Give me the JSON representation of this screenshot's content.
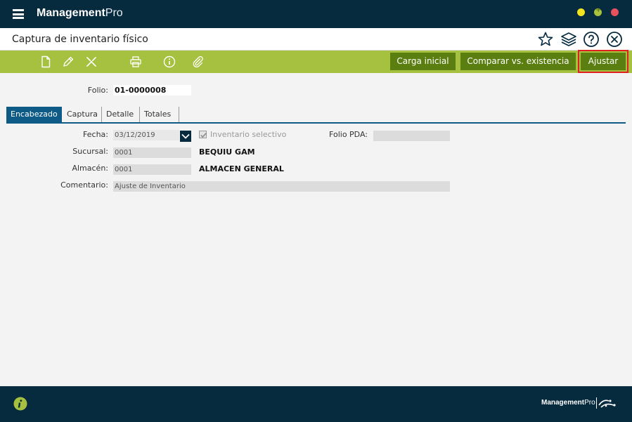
{
  "app": {
    "brand_bold": "Management",
    "brand_light": "Pro"
  },
  "header": {
    "title": "Captura de inventario físico"
  },
  "toolbar": {
    "buttons": {
      "carga_inicial": "Carga inicial",
      "comparar": "Comparar vs. existencia",
      "ajustar": "Ajustar"
    }
  },
  "form": {
    "folio_label": "Folio:",
    "folio_value": "01-0000008",
    "tabs": [
      "Encabezado",
      "Captura",
      "Detalle",
      "Totales"
    ],
    "fecha_label": "Fecha:",
    "fecha_value": "03/12/2019",
    "inventario_selectivo_label": "Inventario selectivo",
    "folio_pda_label": "Folio PDA:",
    "folio_pda_value": "",
    "sucursal_label": "Sucursal:",
    "sucursal_code": "0001",
    "sucursal_name": "BEQUIU GAM",
    "almacen_label": "Almacén:",
    "almacen_code": "0001",
    "almacen_name": "ALMACEN GENERAL",
    "comentario_label": "Comentario:",
    "comentario_value": "Ajuste de Inventario"
  },
  "footer": {
    "brand_bold": "Management",
    "brand_light": "Pro"
  },
  "colors": {
    "titlebar": "#062a3e",
    "toolbar": "#a6c13f",
    "toolbar_button": "#5a7f10",
    "active_tab": "#0e5b87",
    "highlight": "#e02020"
  },
  "icons": [
    "menu-icon",
    "star-icon",
    "layers-icon",
    "help-icon",
    "close-circle-icon",
    "new-document-icon",
    "edit-icon",
    "delete-icon",
    "print-icon",
    "info-icon",
    "attach-icon",
    "chevron-down-icon",
    "checkmark-icon"
  ]
}
